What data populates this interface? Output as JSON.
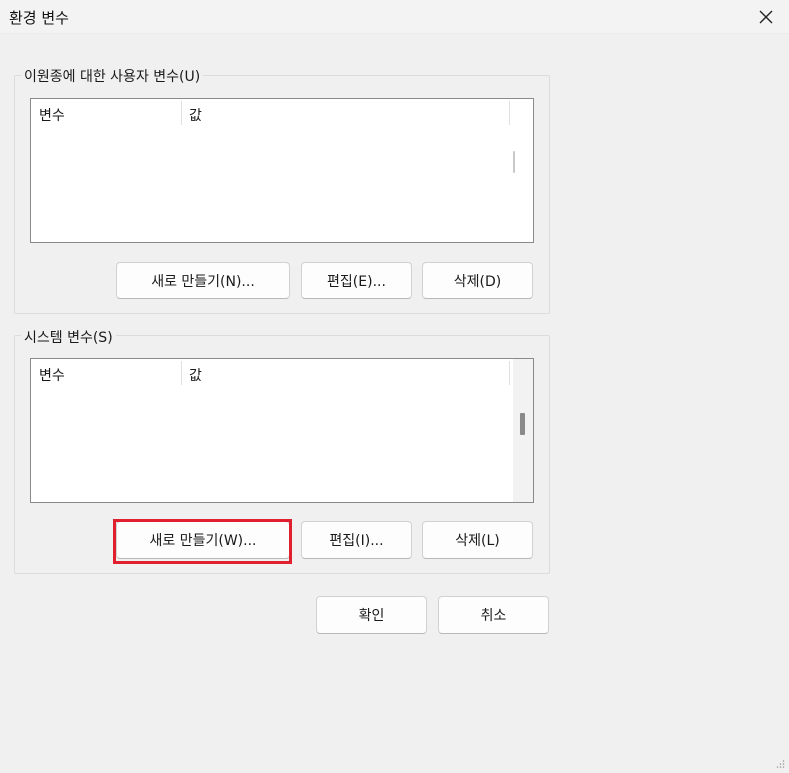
{
  "window": {
    "title": "환경 변수"
  },
  "user_vars": {
    "group_label": "이원종에 대한 사용자 변수(U)",
    "columns": [
      "변수",
      "값"
    ],
    "new_button": "새로 만들기(N)...",
    "edit_button": "편집(E)...",
    "delete_button": "삭제(D)"
  },
  "system_vars": {
    "group_label": "시스템 변수(S)",
    "columns": [
      "변수",
      "값"
    ],
    "new_button": "새로 만들기(W)...",
    "edit_button": "편집(I)...",
    "delete_button": "삭제(L)"
  },
  "footer": {
    "ok_button": "확인",
    "cancel_button": "취소"
  },
  "colors": {
    "highlight": "#e0202e",
    "background": "#f0f0f0"
  }
}
